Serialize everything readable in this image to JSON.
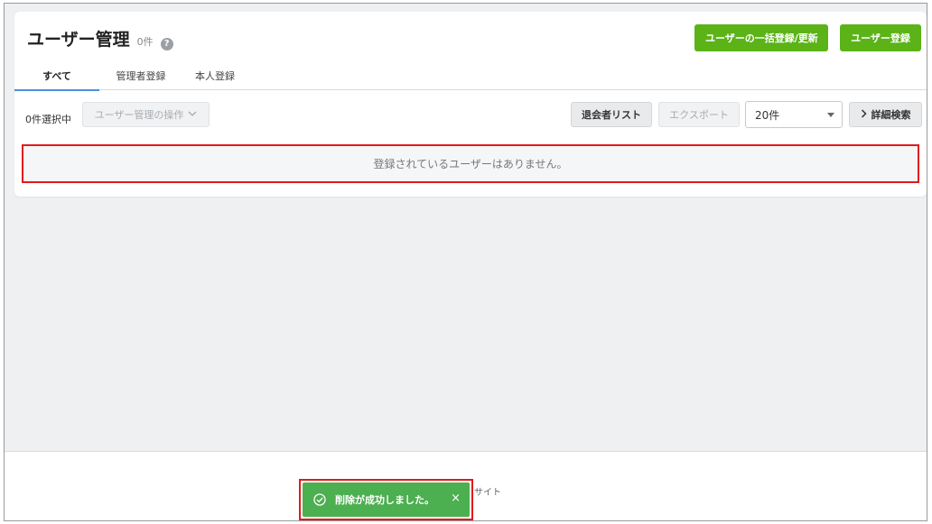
{
  "header": {
    "title": "ユーザー管理",
    "count": "0件",
    "help_icon": "?",
    "bulk_button": "ユーザーの一括登録/更新",
    "register_button": "ユーザー登録"
  },
  "tabs": [
    {
      "label": "すべて",
      "active": true
    },
    {
      "label": "管理者登録",
      "active": false
    },
    {
      "label": "本人登録",
      "active": false
    }
  ],
  "toolbar": {
    "selected_text": "0件選択中",
    "actions_button": "ユーザー管理の操作",
    "actions_icon": "chevron-down-icon",
    "withdrawn_button": "退会者リスト",
    "export_button": "エクスポート",
    "page_size": "20件",
    "advanced_search": "詳細検索",
    "advanced_search_icon": "chevron-right-icon"
  },
  "empty_message": "登録されているユーザーはありません。",
  "footer": {
    "text": "サイト"
  },
  "toast": {
    "icon": "check-circle-icon",
    "message": "削除が成功しました。",
    "close": "×"
  },
  "colors": {
    "accent_green": "#5bb318",
    "toast_green": "#4caf50",
    "highlight_red": "#e01b1b",
    "tab_underline": "#4a90d9"
  }
}
